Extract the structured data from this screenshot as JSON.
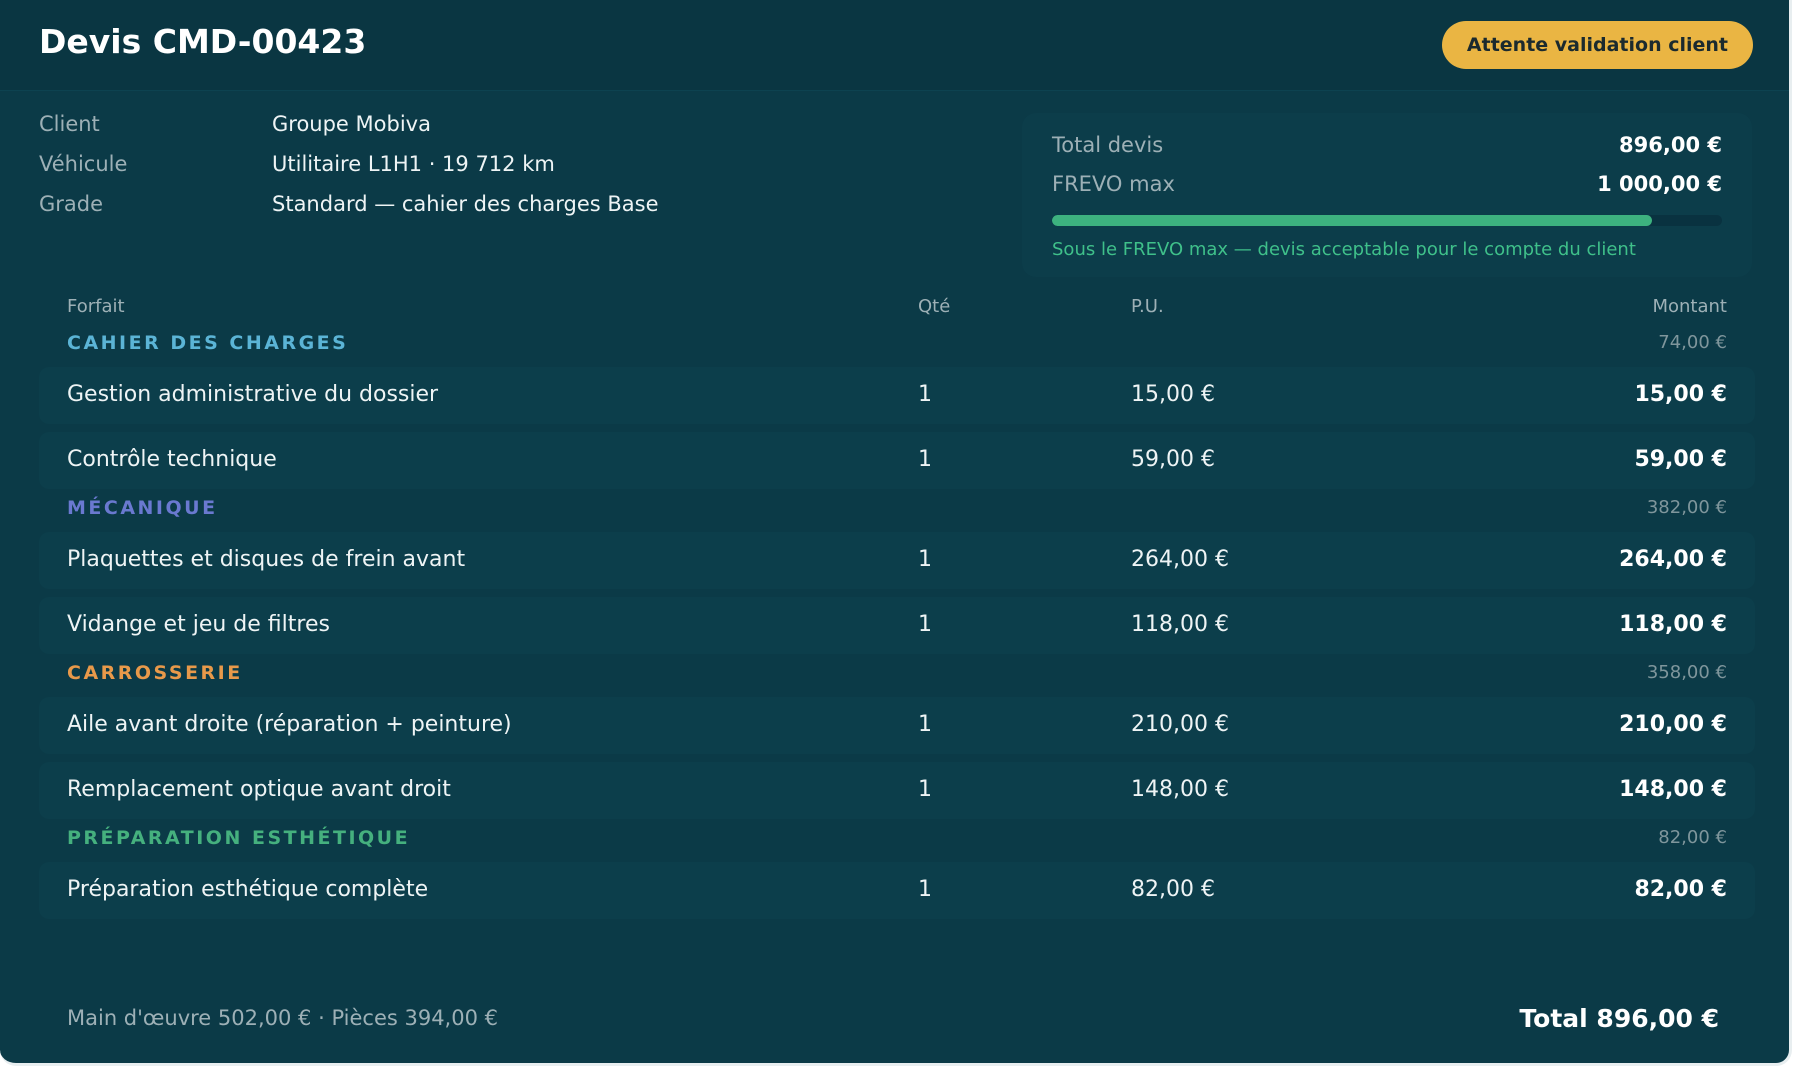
{
  "quote": {
    "title": "Devis CMD-00423",
    "status": "Attente validation client",
    "status_color": "#eab543"
  },
  "meta": [
    {
      "label": "Client",
      "value": "Groupe Mobiva"
    },
    {
      "label": "Véhicule",
      "value": "Utilitaire L1H1 · 19 712 km"
    },
    {
      "label": "Grade",
      "value": "Standard — cahier des charges Base"
    }
  ],
  "summary": {
    "total_label": "Total devis",
    "total_value": "896,00 €",
    "frevo_label": "FREVO max",
    "frevo_value": "1 000,00 €",
    "progress": 0.896,
    "note": "Sous le FREVO max — devis acceptable pour le compte du client",
    "accent_color": "#3db27f"
  },
  "table": {
    "columns": {
      "name": "Forfait",
      "qty": "Qté",
      "pu": "P.U.",
      "amount": "Montant"
    },
    "groups": [
      {
        "title": "CAHIER DES CHARGES",
        "color": "#5bb4d6",
        "total": "74,00 €",
        "items": [
          {
            "name": "Gestion administrative du dossier",
            "qty": "1",
            "pu": "15,00 €",
            "amount": "15,00 €"
          },
          {
            "name": "Contrôle technique",
            "qty": "1",
            "pu": "59,00 €",
            "amount": "59,00 €"
          }
        ]
      },
      {
        "title": "MÉCANIQUE",
        "color": "#6a79d0",
        "total": "382,00 €",
        "items": [
          {
            "name": "Plaquettes et disques de frein avant",
            "qty": "1",
            "pu": "264,00 €",
            "amount": "264,00 €"
          },
          {
            "name": "Vidange et jeu de filtres",
            "qty": "1",
            "pu": "118,00 €",
            "amount": "118,00 €"
          }
        ]
      },
      {
        "title": "CARROSSERIE",
        "color": "#e8994a",
        "total": "358,00 €",
        "items": [
          {
            "name": "Aile avant droite (réparation + peinture)",
            "qty": "1",
            "pu": "210,00 €",
            "amount": "210,00 €"
          },
          {
            "name": "Remplacement optique avant droit",
            "qty": "1",
            "pu": "148,00 €",
            "amount": "148,00 €"
          }
        ]
      },
      {
        "title": "PRÉPARATION ESTHÉTIQUE",
        "color": "#45b07e",
        "total": "82,00 €",
        "items": [
          {
            "name": "Préparation esthétique complète",
            "qty": "1",
            "pu": "82,00 €",
            "amount": "82,00 €"
          }
        ]
      }
    ]
  },
  "footer": {
    "split": "Main d'œuvre 502,00 € · Pièces 394,00 €",
    "total": "Total 896,00 €"
  }
}
